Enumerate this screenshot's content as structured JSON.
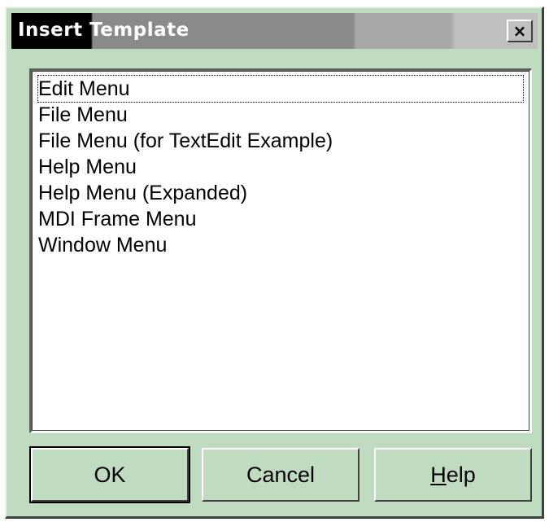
{
  "window": {
    "title": "Insert Template",
    "close_label": "×"
  },
  "list": {
    "items": [
      {
        "label": "Edit Menu"
      },
      {
        "label": "File Menu"
      },
      {
        "label": "File Menu (for TextEdit Example)"
      },
      {
        "label": "Help Menu"
      },
      {
        "label": "Help Menu (Expanded)"
      },
      {
        "label": "MDI Frame Menu"
      },
      {
        "label": "Window Menu"
      }
    ]
  },
  "buttons": {
    "ok_label": "OK",
    "cancel_label": "Cancel",
    "help_mnemonic": "H",
    "help_rest": "elp"
  },
  "colors": {
    "dialog_background": "#c0dcc0",
    "title_active": "#000000",
    "title_inactive": "#8a8a8a"
  }
}
